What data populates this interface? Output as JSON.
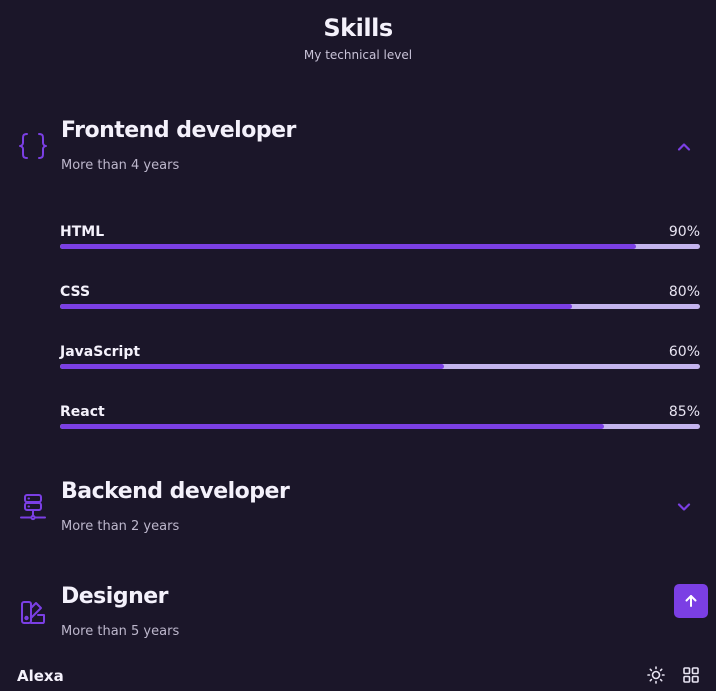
{
  "header": {
    "title": "Skills",
    "subtitle": "My technical level"
  },
  "groups": [
    {
      "title": "Frontend developer",
      "subtitle": "More than 4 years",
      "icon": "brackets-icon",
      "expanded": true,
      "skills": [
        {
          "name": "HTML",
          "percent_label": "90%",
          "level": 90
        },
        {
          "name": "CSS",
          "percent_label": "80%",
          "level": 80
        },
        {
          "name": "JavaScript",
          "percent_label": "60%",
          "level": 60
        },
        {
          "name": "React",
          "percent_label": "85%",
          "level": 85
        }
      ]
    },
    {
      "title": "Backend developer",
      "subtitle": "More than 2 years",
      "icon": "server-icon",
      "expanded": false
    },
    {
      "title": "Designer",
      "subtitle": "More than 5 years",
      "icon": "swatchbook-icon",
      "expanded": false
    }
  ],
  "footer": {
    "brand": "Alexa"
  },
  "colors": {
    "accent": "#7b3fe4",
    "track": "#c4b4ee",
    "background": "#1b1629"
  }
}
